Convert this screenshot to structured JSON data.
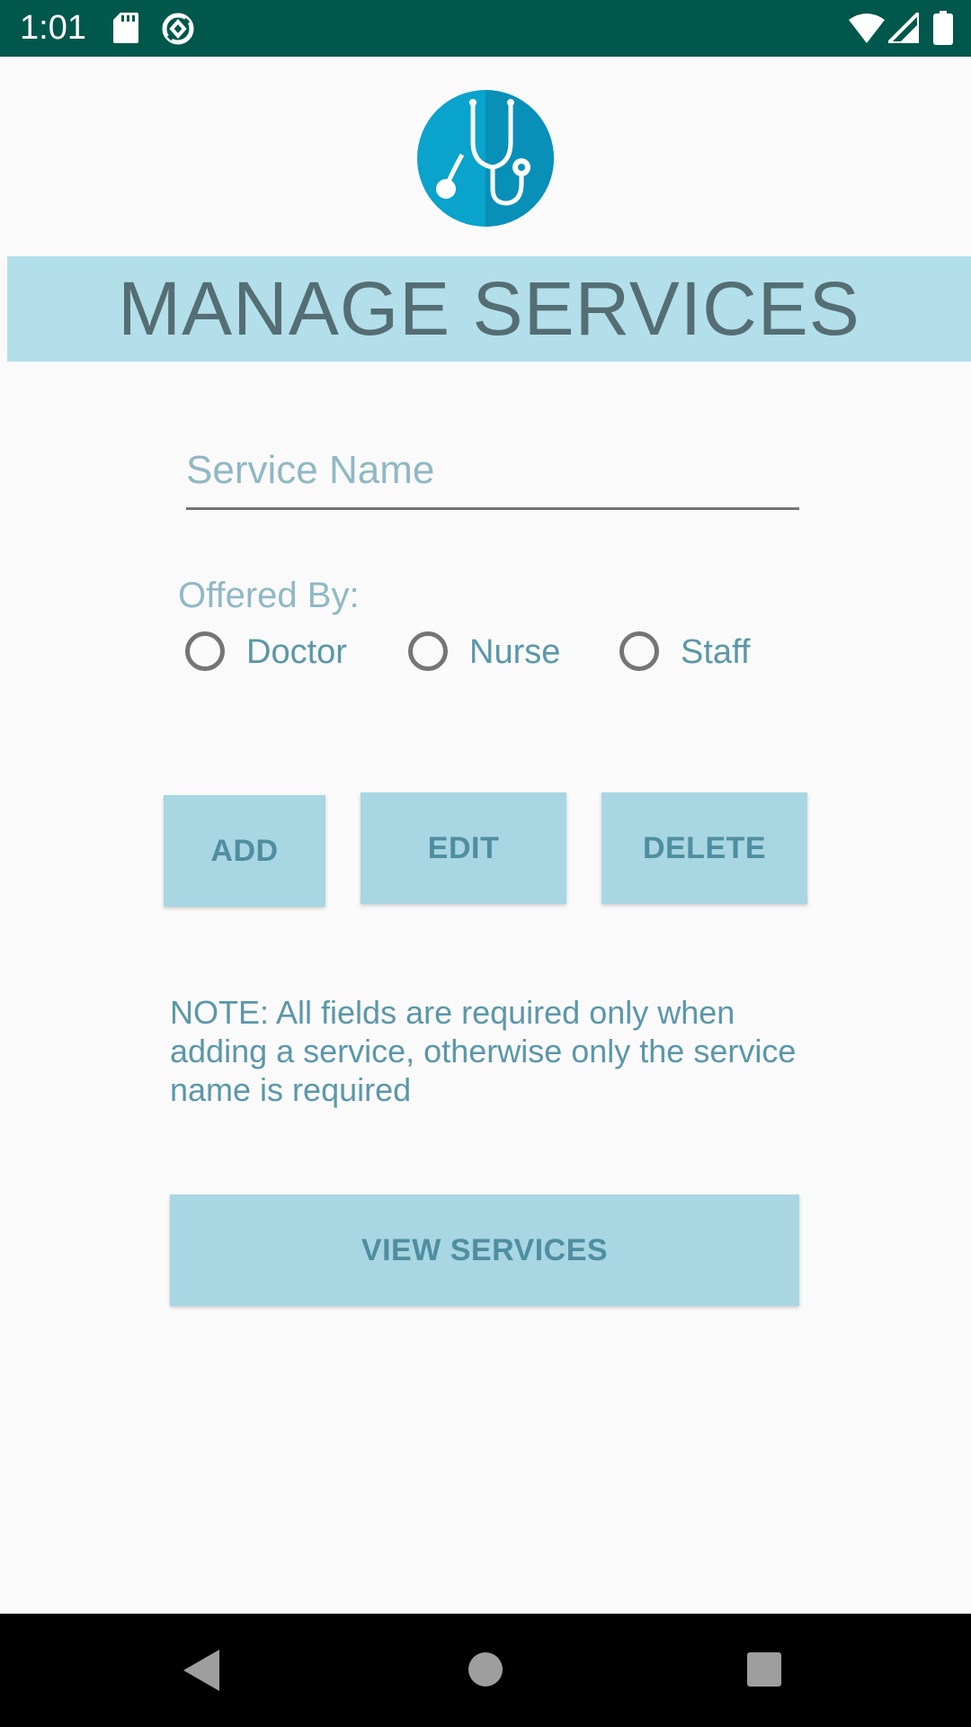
{
  "status_bar": {
    "time": "1:01",
    "icons": [
      "sd-card-icon",
      "data-saver-icon",
      "wifi-icon",
      "cell-signal-icon",
      "battery-icon"
    ],
    "background_color": "#00574b"
  },
  "header": {
    "logo_icon": "stethoscope-icon",
    "title": "MANAGE SERVICES"
  },
  "form": {
    "service_name_placeholder": "Service Name",
    "service_name_value": "",
    "offered_by_label": "Offered By:",
    "options": [
      {
        "label": "Doctor",
        "selected": false
      },
      {
        "label": "Nurse",
        "selected": false
      },
      {
        "label": "Staff",
        "selected": false
      }
    ]
  },
  "buttons": {
    "add": "ADD",
    "edit": "EDIT",
    "delete": "DELETE",
    "view_services": "VIEW SERVICES"
  },
  "note": "NOTE: All fields are required only when adding a service, otherwise only the service name is required",
  "nav_bar": {
    "icons": [
      "back-icon",
      "home-icon",
      "recents-icon"
    ]
  },
  "colors": {
    "banner": "#b2dfea",
    "button": "#a8d6e2",
    "accent_text": "#5b97a8",
    "logo_blue": "#09a3cc"
  }
}
